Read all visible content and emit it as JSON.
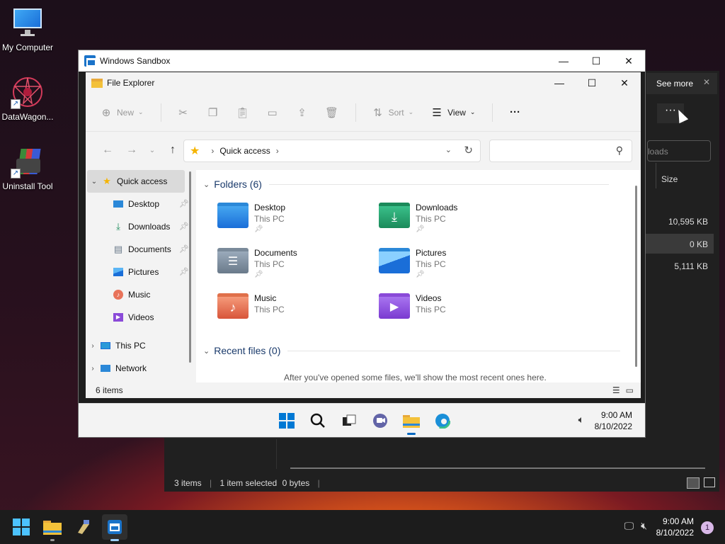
{
  "desktop": {
    "icons": [
      {
        "label": "My Computer"
      },
      {
        "label": "DataWagon..."
      },
      {
        "label": "Uninstall Tool"
      }
    ]
  },
  "background_explorer": {
    "tooltip": "See more",
    "search_placeholder": "loads",
    "column_size": "Size",
    "sizes": [
      "10,595 KB",
      "0 KB",
      "5,111 KB"
    ],
    "status": {
      "items": "3 items",
      "selected": "1 item selected",
      "bytes": "0 bytes"
    }
  },
  "sandbox": {
    "title": "Windows Sandbox"
  },
  "file_explorer": {
    "title": "File Explorer",
    "commands": {
      "new": "New",
      "sort": "Sort",
      "view": "View"
    },
    "breadcrumb": "Quick access",
    "nav": {
      "quick_access": "Quick access",
      "items": [
        "Desktop",
        "Downloads",
        "Documents",
        "Pictures",
        "Music",
        "Videos"
      ],
      "this_pc": "This PC",
      "network": "Network"
    },
    "folders_header": "Folders (6)",
    "folders": [
      {
        "name": "Desktop",
        "location": "This PC"
      },
      {
        "name": "Downloads",
        "location": "This PC"
      },
      {
        "name": "Documents",
        "location": "This PC"
      },
      {
        "name": "Pictures",
        "location": "This PC"
      },
      {
        "name": "Music",
        "location": "This PC"
      },
      {
        "name": "Videos",
        "location": "This PC"
      }
    ],
    "recent_header": "Recent files (0)",
    "recent_empty": "After you've opened some files, we'll show the most recent ones here.",
    "status": "6 items"
  },
  "inner_taskbar": {
    "time": "9:00 AM",
    "date": "8/10/2022"
  },
  "host_taskbar": {
    "time": "9:00 AM",
    "date": "8/10/2022",
    "notification_count": "1"
  },
  "colors": {
    "accent": "#0067c0",
    "folder": "#f3c13a"
  }
}
